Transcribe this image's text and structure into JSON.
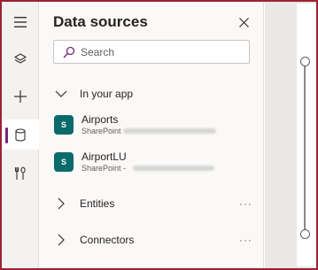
{
  "panel": {
    "title": "Data sources",
    "search_placeholder": "Search"
  },
  "sections": {
    "in_your_app": "In your app",
    "entities": "Entities",
    "connectors": "Connectors",
    "more_label": "···"
  },
  "sources": [
    {
      "name": "Airports",
      "type": "SharePoint",
      "icon": "S"
    },
    {
      "name": "AirportLU",
      "type": "SharePoint -",
      "icon": "S"
    }
  ],
  "rail": {
    "icons": [
      "hamburger-icon",
      "layers-icon",
      "plus-icon",
      "database-icon",
      "tools-icon"
    ],
    "active": "database-icon"
  },
  "colors": {
    "accent": "#742774",
    "sharepoint": "#0b6a6a",
    "frame_border": "#9b2335"
  }
}
